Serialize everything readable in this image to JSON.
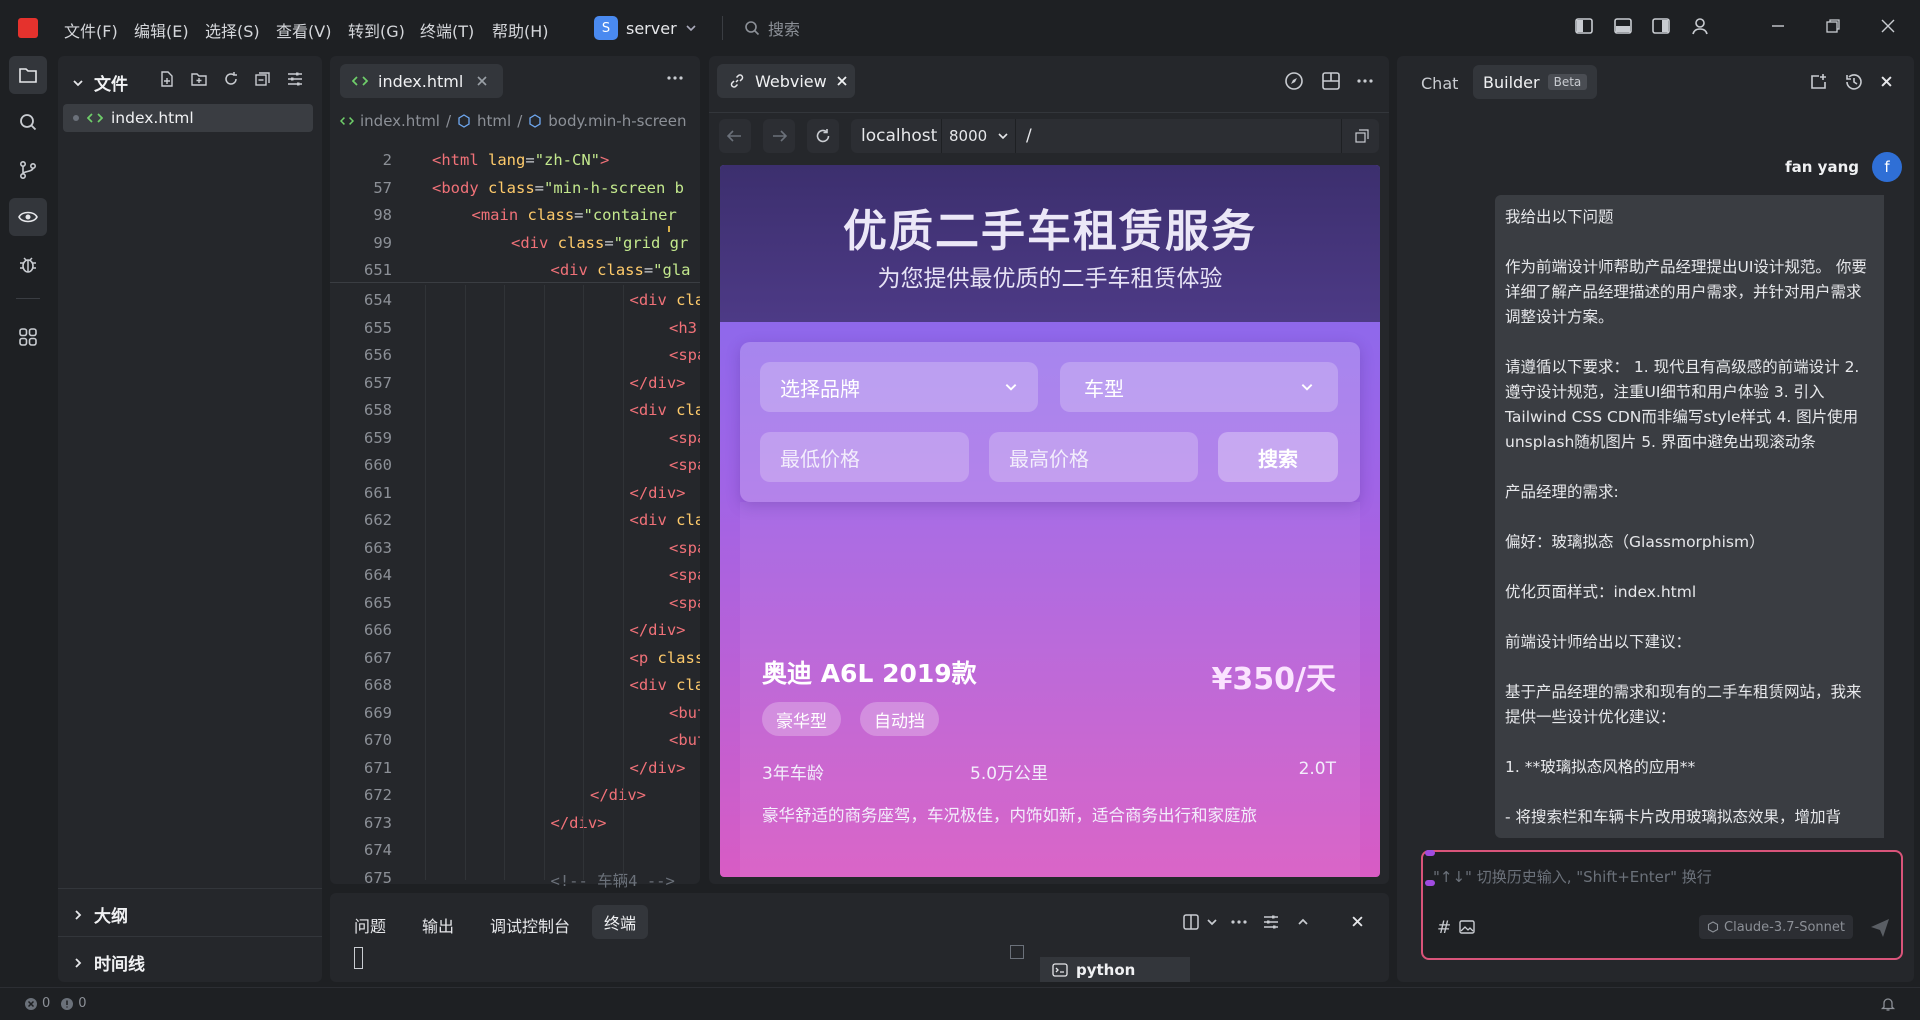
{
  "menu": {
    "file": "文件(F)",
    "edit": "编辑(E)",
    "select": "选择(S)",
    "view": "查看(V)",
    "goto": "转到(G)",
    "terminal": "终端(T)",
    "help": "帮助(H)"
  },
  "workspace": {
    "initial": "S",
    "name": "server"
  },
  "search": {
    "placeholder": "搜索"
  },
  "explorer": {
    "title": "文件",
    "file": "index.html",
    "outline": "大纲",
    "timeline": "时间线"
  },
  "editor": {
    "tab": "index.html",
    "breadcrumb": [
      "index.html",
      "html",
      "body.min-h-screen"
    ],
    "sticky": [
      {
        "n": "2",
        "indent": 0,
        "parts": [
          [
            "tg",
            "<html"
          ],
          [
            "at",
            " lang"
          ],
          [
            "pl",
            "="
          ],
          [
            "st",
            "\"zh-CN\""
          ],
          [
            "tg",
            ">"
          ]
        ]
      },
      {
        "n": "57",
        "indent": 0,
        "parts": [
          [
            "tg",
            "<body"
          ],
          [
            "at",
            " class"
          ],
          [
            "pl",
            "="
          ],
          [
            "st",
            "\"min-h-screen b"
          ]
        ]
      },
      {
        "n": "98",
        "indent": 1,
        "parts": [
          [
            "tg",
            "<main"
          ],
          [
            "at",
            " class"
          ],
          [
            "pl",
            "="
          ],
          [
            "st",
            "\"container"
          ]
        ]
      },
      {
        "n": "99",
        "indent": 2,
        "parts": [
          [
            "tg",
            "<div"
          ],
          [
            "at",
            " class"
          ],
          [
            "pl",
            "="
          ],
          [
            "st",
            "\"grid gr"
          ]
        ]
      },
      {
        "n": "651",
        "indent": 3,
        "parts": [
          [
            "tg",
            "<div"
          ],
          [
            "at",
            " class"
          ],
          [
            "pl",
            "="
          ],
          [
            "st",
            "\"gla"
          ]
        ]
      }
    ],
    "lines": [
      {
        "n": "654",
        "indent": 5,
        "parts": [
          [
            "tg",
            "<div"
          ],
          [
            "at",
            " cla"
          ]
        ]
      },
      {
        "n": "655",
        "indent": 6,
        "parts": [
          [
            "tg",
            "<h3"
          ]
        ]
      },
      {
        "n": "656",
        "indent": 6,
        "parts": [
          [
            "tg",
            "<spa"
          ]
        ]
      },
      {
        "n": "657",
        "indent": 5,
        "parts": [
          [
            "tg",
            "</div>"
          ]
        ]
      },
      {
        "n": "658",
        "indent": 5,
        "parts": [
          [
            "tg",
            "<div"
          ],
          [
            "at",
            " cla"
          ]
        ]
      },
      {
        "n": "659",
        "indent": 6,
        "parts": [
          [
            "tg",
            "<spa"
          ]
        ]
      },
      {
        "n": "660",
        "indent": 6,
        "parts": [
          [
            "tg",
            "<spa"
          ]
        ]
      },
      {
        "n": "661",
        "indent": 5,
        "parts": [
          [
            "tg",
            "</div>"
          ]
        ]
      },
      {
        "n": "662",
        "indent": 5,
        "parts": [
          [
            "tg",
            "<div"
          ],
          [
            "at",
            " cla"
          ]
        ]
      },
      {
        "n": "663",
        "indent": 6,
        "parts": [
          [
            "tg",
            "<spa"
          ]
        ]
      },
      {
        "n": "664",
        "indent": 6,
        "parts": [
          [
            "tg",
            "<spa"
          ]
        ]
      },
      {
        "n": "665",
        "indent": 6,
        "parts": [
          [
            "tg",
            "<spa"
          ]
        ]
      },
      {
        "n": "666",
        "indent": 5,
        "parts": [
          [
            "tg",
            "</div>"
          ]
        ]
      },
      {
        "n": "667",
        "indent": 5,
        "parts": [
          [
            "tg",
            "<p"
          ],
          [
            "at",
            " class"
          ]
        ]
      },
      {
        "n": "668",
        "indent": 5,
        "parts": [
          [
            "tg",
            "<div"
          ],
          [
            "at",
            " cla"
          ]
        ]
      },
      {
        "n": "669",
        "indent": 6,
        "parts": [
          [
            "tg",
            "<but"
          ]
        ]
      },
      {
        "n": "670",
        "indent": 6,
        "parts": [
          [
            "tg",
            "<but"
          ]
        ]
      },
      {
        "n": "671",
        "indent": 5,
        "parts": [
          [
            "tg",
            "</div>"
          ]
        ]
      },
      {
        "n": "672",
        "indent": 4,
        "parts": [
          [
            "tg",
            "</div>"
          ]
        ]
      },
      {
        "n": "673",
        "indent": 3,
        "parts": [
          [
            "tg",
            "</div>"
          ]
        ]
      },
      {
        "n": "674",
        "indent": 0,
        "parts": []
      },
      {
        "n": "675",
        "indent": 3,
        "parts": [
          [
            "cm",
            "<!-- 车辆4 -->"
          ]
        ]
      }
    ]
  },
  "webview": {
    "tab": "Webview",
    "host": "localhost",
    "port": "8000",
    "path": "/",
    "hero_title": "优质二手车租赁服务",
    "hero_subtitle": "为您提供最优质的二手车租赁体验",
    "brand_select": "选择品牌",
    "type_select": "车型",
    "min_price": "最低价格",
    "max_price": "最高价格",
    "search_btn": "搜索",
    "car": {
      "name": "奥迪 A6L 2019款",
      "price": "¥350/天",
      "tags": [
        "豪华型",
        "自动挡"
      ],
      "age": "3年车龄",
      "mileage": "5.0万公里",
      "engine": "2.0T",
      "desc": "豪华舒适的商务座驾，车况极佳，内饰如新，适合商务出行和家庭旅"
    }
  },
  "bottom_panel": {
    "tabs": [
      "问题",
      "输出",
      "调试控制台",
      "终端"
    ],
    "active": "终端",
    "terminal_name": "python"
  },
  "chat": {
    "tab_chat": "Chat",
    "tab_builder": "Builder",
    "beta": "Beta",
    "user": "fan yang",
    "avatar": "f",
    "paragraphs": [
      "我给出以下问题",
      "作为前端设计师帮助产品经理提出UI设计规范。 你要详细了解产品经理描述的用户需求，并针对用户需求调整设计方案。",
      "请遵循以下要求： 1. 现代且有高级感的前端设计 2. 遵守设计规范，注重UI细节和用户体验 3. 引入Tailwind CSS CDN而非编写style样式 4. 图片使用unsplash随机图片 5. 界面中避免出现滚动条",
      "产品经理的需求:",
      "偏好：玻璃拟态（Glassmorphism）",
      "优化页面样式：index.html",
      "前端设计师给出以下建议：",
      "基于产品经理的需求和现有的二手车租赁网站，我来提供一些设计优化建议：",
      "1. **玻璃拟态风格的应用**",
      "- 将搜索栏和车辆卡片改用玻璃拟态效果，增加背"
    ],
    "input_placeholder": "\"↑↓\" 切换历史输入, \"Shift+Enter\" 换行",
    "model": "Claude-3.7-Sonnet"
  },
  "status": {
    "errors": "0",
    "warnings": "0"
  }
}
